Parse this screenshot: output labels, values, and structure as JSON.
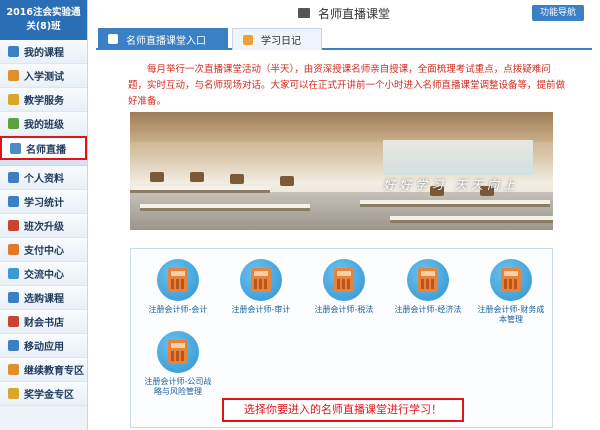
{
  "sidebar": {
    "header": "2016注会实验通关(8)班",
    "group1": [
      {
        "label": "我的课程",
        "icon": "books-icon",
        "color": "#3b7fc4"
      },
      {
        "label": "入学测试",
        "icon": "test-paper-icon",
        "color": "#e0902a"
      },
      {
        "label": "教学服务",
        "icon": "service-icon",
        "color": "#d9a62a"
      },
      {
        "label": "我的班级",
        "icon": "class-icon",
        "color": "#5aa23a"
      },
      {
        "label": "名师直播",
        "icon": "live-icon",
        "color": "#4a8bc8"
      }
    ],
    "group2": [
      {
        "label": "个人资料",
        "icon": "user-icon",
        "color": "#3b7fc4"
      },
      {
        "label": "学习统计",
        "icon": "chart-icon",
        "color": "#3b7fc4"
      },
      {
        "label": "班次升级",
        "icon": "upgrade-icon",
        "color": "#c8442a"
      },
      {
        "label": "支付中心",
        "icon": "payment-icon",
        "color": "#e07a2a"
      },
      {
        "label": "交流中心",
        "icon": "chat-icon",
        "color": "#3b9ad1"
      },
      {
        "label": "选购课程",
        "icon": "cart-icon",
        "color": "#3b7fc4"
      },
      {
        "label": "财会书店",
        "icon": "book-icon",
        "color": "#c8442a"
      },
      {
        "label": "移动应用",
        "icon": "mobile-icon",
        "color": "#3b7fc4"
      },
      {
        "label": "继续教育专区",
        "icon": "education-icon",
        "color": "#e0902a"
      },
      {
        "label": "奖学金专区",
        "icon": "scholarship-icon",
        "color": "#d9a62a"
      }
    ]
  },
  "header": {
    "title": "名师直播课堂",
    "nav_button": "功能导航"
  },
  "tabs": [
    {
      "label": "名师直播课堂入口"
    },
    {
      "label": "学习日记"
    }
  ],
  "notice": "每月举行一次直播课堂活动（半天），由资深授课名师亲自授课，全面梳理考试重点，点拨疑难问题，实时互动，与名师现场对话。大家可以在正式开讲前一个小时进入名师直播课堂调整设备等，提前做好准备。",
  "banner": {
    "slogan": "好好学习  天天向上"
  },
  "cards": [
    {
      "label": "注册会计师-会计"
    },
    {
      "label": "注册会计师-审计"
    },
    {
      "label": "注册会计师-税法"
    },
    {
      "label": "注册会计师-经济法"
    },
    {
      "label": "注册会计师-财务成本管理"
    },
    {
      "label": "注册会计师-公司战略与风险管理"
    }
  ],
  "cta": "选择你要进入的名师直播课堂进行学习！"
}
